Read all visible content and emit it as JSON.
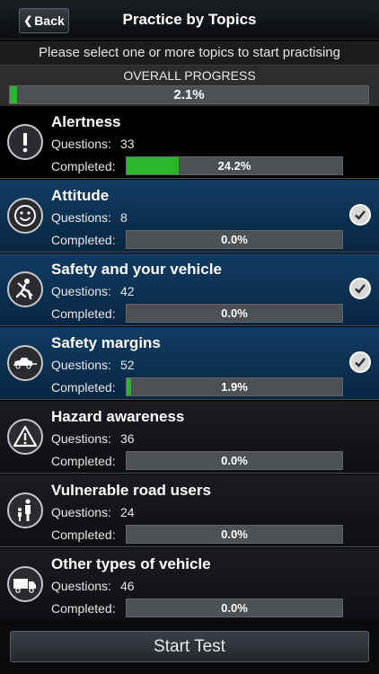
{
  "navbar": {
    "back_label": "Back",
    "title": "Practice by Topics"
  },
  "instruction": "Please select one or more topics to start practising",
  "overall": {
    "label": "OVERALL PROGRESS",
    "percent_text": "2.1%",
    "percent": 2.1
  },
  "labels": {
    "questions": "Questions:",
    "completed": "Completed:"
  },
  "topics": [
    {
      "title": "Alertness",
      "questions": "33",
      "completed_text": "24.2%",
      "completed": 24.2,
      "selected": false,
      "icon": "exclamation-icon"
    },
    {
      "title": "Attitude",
      "questions": "8",
      "completed_text": "0.0%",
      "completed": 0,
      "selected": true,
      "icon": "smiley-icon"
    },
    {
      "title": "Safety and your vehicle",
      "questions": "42",
      "completed_text": "0.0%",
      "completed": 0,
      "selected": true,
      "icon": "seatbelt-icon"
    },
    {
      "title": "Safety margins",
      "questions": "52",
      "completed_text": "1.9%",
      "completed": 1.9,
      "selected": true,
      "icon": "car-tow-icon"
    },
    {
      "title": "Hazard awareness",
      "questions": "36",
      "completed_text": "0.0%",
      "completed": 0,
      "selected": false,
      "icon": "warning-triangle-icon"
    },
    {
      "title": "Vulnerable road users",
      "questions": "24",
      "completed_text": "0.0%",
      "completed": 0,
      "selected": false,
      "icon": "pedestrian-icon"
    },
    {
      "title": "Other types of vehicle",
      "questions": "46",
      "completed_text": "0.0%",
      "completed": 0,
      "selected": false,
      "icon": "truck-icon"
    }
  ],
  "start_button": "Start Test",
  "colors": {
    "progress": "#2db52d",
    "selected_bg": "#123c63"
  }
}
